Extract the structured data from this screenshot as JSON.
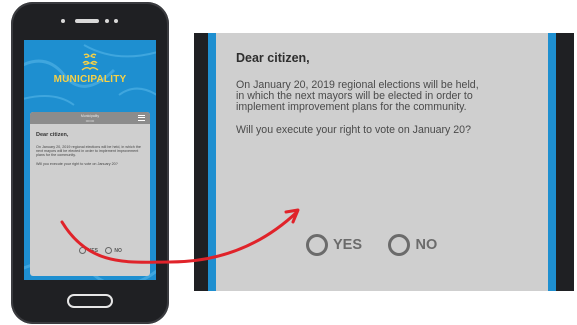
{
  "colors": {
    "screen_blue": "#1e8fd0",
    "logo_gold": "#f7d146",
    "card_gray": "#cfcfcf",
    "arrow_red": "#e0232a",
    "phone_body": "#1f2023"
  },
  "phone": {
    "logo_text": "MUNICIPALITY",
    "app_bar_title": "Municipality",
    "app_bar_dots": "•••••••",
    "greeting": "Dear citizen,",
    "paragraph_1": "On January 20, 2019 regional elections will be held, in which the next mayors will be elected in order to implement improvement plans for the community.",
    "paragraph_2": "Will you execute your right to vote on January 20?",
    "options": [
      "YES",
      "NO"
    ]
  },
  "zoom": {
    "greeting": "Dear citizen,",
    "paragraph_1_lines": [
      "On January 20, 2019 regional elections will be held,",
      "in which the next mayors will be elected in order to",
      "implement improvement plans for the community."
    ],
    "paragraph_2": "Will you execute your right to vote on January 20?",
    "options": [
      "YES",
      "NO"
    ]
  },
  "icons": {
    "logo": "municipality-logo-icon",
    "menu": "hamburger-menu-icon",
    "radio": "radio-button-icon",
    "arrow": "curved-arrow-icon"
  }
}
